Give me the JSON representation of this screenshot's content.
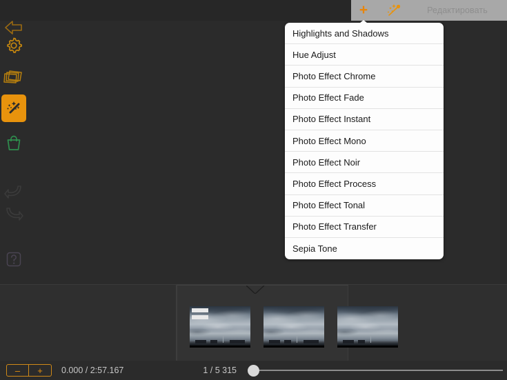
{
  "topbar": {
    "add_icon": "plus-icon",
    "wand_icon": "magic-wand-icon",
    "edit_label": "Редактировать"
  },
  "sidebar": {
    "items": [
      {
        "name": "back-arrow-icon",
        "label": "Back",
        "color": "#9a6a12",
        "state": "normal"
      },
      {
        "name": "gear-icon",
        "label": "Settings",
        "color": "#c4860f",
        "state": "normal"
      },
      {
        "name": "layers-icon",
        "label": "Layers",
        "color": "#b8800e",
        "state": "normal"
      },
      {
        "name": "magic-wand-icon",
        "label": "Effects",
        "color": "#2b2b2b",
        "state": "active"
      },
      {
        "name": "shopping-bag-icon",
        "label": "Store",
        "color": "#2f8f4e",
        "state": "normal"
      },
      {
        "name": "undo-icon",
        "label": "Undo",
        "color": "#3c3c3c",
        "state": "disabled"
      },
      {
        "name": "redo-icon",
        "label": "Redo",
        "color": "#3c3c3c",
        "state": "disabled"
      },
      {
        "name": "help-icon",
        "label": "Help",
        "color": "#4a4452",
        "state": "normal"
      }
    ],
    "active_background": "#e8930d"
  },
  "menu": {
    "items": [
      "Highlights and Shadows",
      "Hue Adjust",
      "Photo Effect Chrome",
      "Photo Effect Fade",
      "Photo Effect Instant",
      "Photo Effect Mono",
      "Photo Effect Noir",
      "Photo Effect Process",
      "Photo Effect Tonal",
      "Photo Effect Transfer",
      "Sepia Tone"
    ]
  },
  "filmstrip": {
    "thumbnails": [
      {
        "alt": "cloudy-sky-frame",
        "selected": true
      },
      {
        "alt": "cloudy-sky-frame",
        "selected": false
      },
      {
        "alt": "cloudy-sky-frame",
        "selected": false
      }
    ]
  },
  "bottombar": {
    "zoom_out_label": "–",
    "zoom_in_label": "+",
    "time_label": "0.000 / 2:57.167",
    "frame_label": "1 / 5 315",
    "slider_value": 2
  },
  "colors": {
    "accent_orange": "#e8930d",
    "canvas_bg": "#2b2b2b",
    "toolbar_gray": "#a8a8a8",
    "green": "#2f8f4e"
  }
}
